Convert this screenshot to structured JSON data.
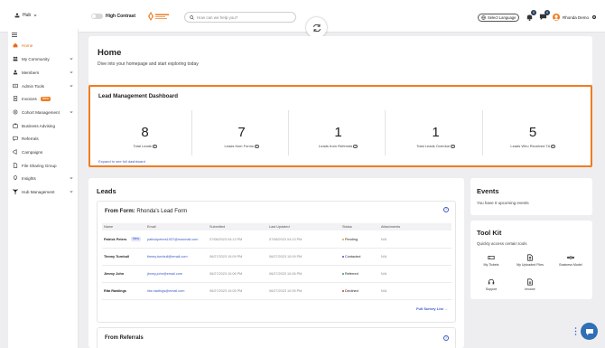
{
  "topbar": {
    "hub_label": "Hub",
    "high_contrast_label": "High Contrast",
    "search_placeholder": "How can we help you?",
    "language_label": "Select Language",
    "notifications_count": "0",
    "messages_count": "0",
    "user_name": "Rhonda Demo"
  },
  "sidebar": {
    "items": [
      {
        "label": "Home",
        "icon": "home-icon",
        "active": true
      },
      {
        "label": "My Community",
        "icon": "community-icon",
        "chevron": true
      },
      {
        "label": "Members",
        "icon": "members-icon",
        "chevron": true
      },
      {
        "label": "Admin Tools",
        "icon": "admin-icon",
        "chevron": true
      },
      {
        "label": "Invoices",
        "icon": "invoice-icon",
        "badge": "New"
      },
      {
        "label": "Cohort Management",
        "icon": "cohort-icon",
        "chevron": true
      },
      {
        "label": "Business Advising",
        "icon": "advising-icon"
      },
      {
        "label": "Referrals",
        "icon": "referrals-icon"
      },
      {
        "label": "Campaigns",
        "icon": "campaigns-icon"
      },
      {
        "label": "File Sharing Group",
        "icon": "file-share-icon"
      },
      {
        "label": "Insights",
        "icon": "insights-icon",
        "chevron": true
      },
      {
        "label": "Hub Management",
        "icon": "hub-mgmt-icon",
        "chevron": true
      }
    ]
  },
  "header": {
    "title": "Home",
    "subtitle": "Dive into your homepage and start exploring today"
  },
  "dashboard": {
    "title": "Lead Management Dashboard",
    "stats": [
      {
        "value": "8",
        "label": "Total Leads"
      },
      {
        "value": "7",
        "label": "Leads from Forms"
      },
      {
        "value": "1",
        "label": "Leads from Referrals"
      },
      {
        "value": "1",
        "label": "Total Leads Overdue"
      },
      {
        "value": "5",
        "label": "Leads Who Received TA"
      }
    ],
    "expand_link": "Expand to see full dashboard"
  },
  "leads": {
    "title": "Leads",
    "form_prefix": "From Form:",
    "form_name": "Rhonda's Lead Form",
    "columns": [
      "Name",
      "Email",
      "Submitted",
      "Last Updated",
      "Status",
      "Attachments"
    ],
    "rows": [
      {
        "name": "Patrick Peters",
        "tag": "New",
        "email": "patrickpeters1937@maxmail.com",
        "submitted": "07/08/2023 04:13 PM",
        "updated": "07/08/2023 04:13 PM",
        "status": "Pending",
        "status_color": "#f0a32a",
        "attachments": "N/A"
      },
      {
        "name": "Timmy Turnbull",
        "tag": "",
        "email": "timmy.turnbull@email.com",
        "submitted": "06/27/2023 10:09 PM",
        "updated": "06/27/2023 10:09 PM",
        "status": "Contacted",
        "status_color": "#3b57c5",
        "attachments": "N/A"
      },
      {
        "name": "Jimmy John",
        "tag": "",
        "email": "jimmy.john@email.com",
        "submitted": "06/27/2023 10:06 PM",
        "updated": "06/27/2023 10:06 PM",
        "status": "Referred",
        "status_color": "#27a35a",
        "attachments": "N/A"
      },
      {
        "name": "Rita Rawlings",
        "tag": "",
        "email": "rita.rawlings@email.com",
        "submitted": "06/27/2023 10:05 PM",
        "updated": "06/27/2023 10:05 PM",
        "status": "Declined",
        "status_color": "#d33a3a",
        "attachments": "N/A"
      }
    ],
    "full_survey_link": "Full Survey List →",
    "referrals_title": "From Referrals"
  },
  "events": {
    "title": "Events",
    "text": "You have 0 upcoming events"
  },
  "toolkit": {
    "title": "Tool Kit",
    "subtitle": "Quickly access certain tools",
    "items": [
      {
        "label": "My Tickets",
        "icon": "tickets-icon"
      },
      {
        "label": "My Uploaded Files",
        "icon": "uploaded-files-icon"
      },
      {
        "label": "Business Model",
        "icon": "business-model-icon"
      },
      {
        "label": "Support",
        "icon": "support-icon"
      },
      {
        "label": "Invoice",
        "icon": "invoice-doc-icon"
      }
    ]
  },
  "colors": {
    "accent": "#f07c1f",
    "link": "#3b57c5"
  }
}
